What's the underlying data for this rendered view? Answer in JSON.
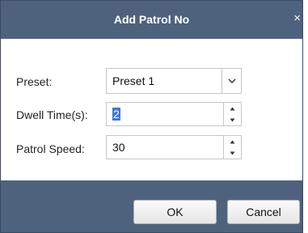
{
  "dialog": {
    "title": "Add Patrol No",
    "close_glyph": "×",
    "fields": {
      "preset_label": "Preset:",
      "preset_value": "Preset 1",
      "dwell_label": "Dwell Time(s):",
      "dwell_value": "2",
      "speed_label": "Patrol Speed:",
      "speed_value": "30"
    },
    "buttons": {
      "ok": "OK",
      "cancel": "Cancel"
    }
  },
  "colors": {
    "titlebar": "#4f627d",
    "footer": "#4f627d",
    "selection": "#3d78d8"
  },
  "icons": [
    "close-icon",
    "chevron-down-icon",
    "spin-up-icon",
    "spin-down-icon"
  ]
}
